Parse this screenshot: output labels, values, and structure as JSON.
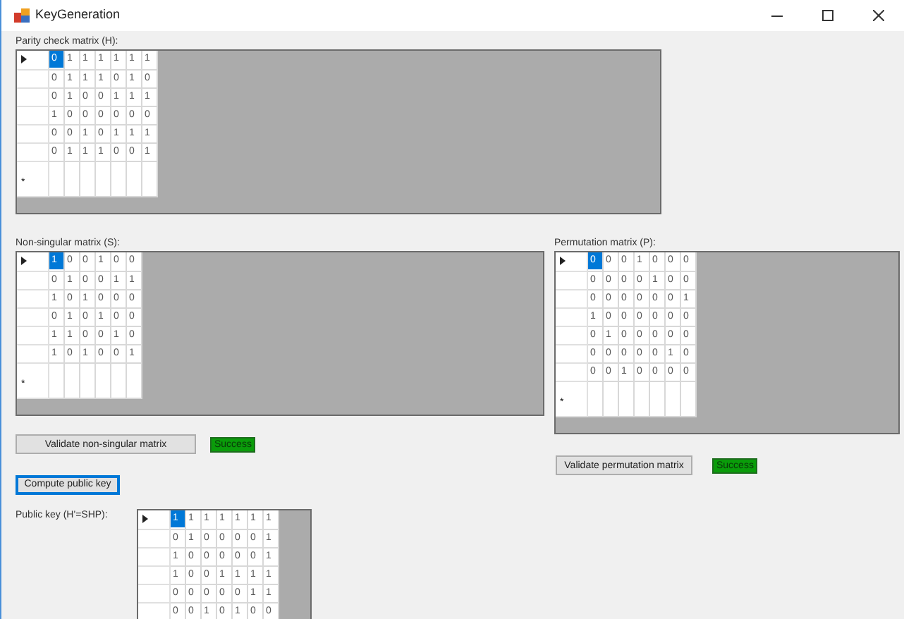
{
  "window": {
    "title": "KeyGeneration"
  },
  "parity_check": {
    "label": "Parity check matrix (H):",
    "new_row_marker": "*",
    "rows": [
      {
        "current": true,
        "cells": [
          "0",
          "1",
          "1",
          "1",
          "1",
          "1",
          "1"
        ]
      },
      {
        "current": false,
        "cells": [
          "0",
          "1",
          "1",
          "1",
          "0",
          "1",
          "0"
        ]
      },
      {
        "current": false,
        "cells": [
          "0",
          "1",
          "0",
          "0",
          "1",
          "1",
          "1"
        ]
      },
      {
        "current": false,
        "cells": [
          "1",
          "0",
          "0",
          "0",
          "0",
          "0",
          "0"
        ]
      },
      {
        "current": false,
        "cells": [
          "0",
          "0",
          "1",
          "0",
          "1",
          "1",
          "1"
        ]
      },
      {
        "current": false,
        "cells": [
          "0",
          "1",
          "1",
          "1",
          "0",
          "0",
          "1"
        ]
      }
    ]
  },
  "non_singular": {
    "label": "Non-singular matrix (S):",
    "new_row_marker": "*",
    "rows": [
      {
        "current": true,
        "cells": [
          "1",
          "0",
          "0",
          "1",
          "0",
          "0"
        ]
      },
      {
        "current": false,
        "cells": [
          "0",
          "1",
          "0",
          "0",
          "1",
          "1"
        ]
      },
      {
        "current": false,
        "cells": [
          "1",
          "0",
          "1",
          "0",
          "0",
          "0"
        ]
      },
      {
        "current": false,
        "cells": [
          "0",
          "1",
          "0",
          "1",
          "0",
          "0"
        ]
      },
      {
        "current": false,
        "cells": [
          "1",
          "1",
          "0",
          "0",
          "1",
          "0"
        ]
      },
      {
        "current": false,
        "cells": [
          "1",
          "0",
          "1",
          "0",
          "0",
          "1"
        ]
      }
    ]
  },
  "permutation": {
    "label": "Permutation matrix (P):",
    "new_row_marker": "*",
    "rows": [
      {
        "current": true,
        "cells": [
          "0",
          "0",
          "0",
          "1",
          "0",
          "0",
          "0"
        ]
      },
      {
        "current": false,
        "cells": [
          "0",
          "0",
          "0",
          "0",
          "1",
          "0",
          "0"
        ]
      },
      {
        "current": false,
        "cells": [
          "0",
          "0",
          "0",
          "0",
          "0",
          "0",
          "1"
        ]
      },
      {
        "current": false,
        "cells": [
          "1",
          "0",
          "0",
          "0",
          "0",
          "0",
          "0"
        ]
      },
      {
        "current": false,
        "cells": [
          "0",
          "1",
          "0",
          "0",
          "0",
          "0",
          "0"
        ]
      },
      {
        "current": false,
        "cells": [
          "0",
          "0",
          "0",
          "0",
          "0",
          "1",
          "0"
        ]
      },
      {
        "current": false,
        "cells": [
          "0",
          "0",
          "1",
          "0",
          "0",
          "0",
          "0"
        ]
      }
    ]
  },
  "validate_non_singular": {
    "label": "Validate non-singular matrix",
    "focused": false,
    "status": "Success"
  },
  "compute_public_key": {
    "label": "Compute public key",
    "focused": true
  },
  "validate_permutation": {
    "label": "Validate permutation matrix",
    "focused": false,
    "status": "Success"
  },
  "public_key": {
    "label": "Public key (H'=SHP):",
    "rows": [
      {
        "current": true,
        "cells": [
          "1",
          "1",
          "1",
          "1",
          "1",
          "1",
          "1"
        ]
      },
      {
        "current": false,
        "cells": [
          "0",
          "1",
          "0",
          "0",
          "0",
          "0",
          "1"
        ]
      },
      {
        "current": false,
        "cells": [
          "1",
          "0",
          "0",
          "0",
          "0",
          "0",
          "1"
        ]
      },
      {
        "current": false,
        "cells": [
          "1",
          "0",
          "0",
          "1",
          "1",
          "1",
          "1"
        ]
      },
      {
        "current": false,
        "cells": [
          "0",
          "0",
          "0",
          "0",
          "0",
          "1",
          "1"
        ]
      },
      {
        "current": false,
        "cells": [
          "0",
          "0",
          "1",
          "0",
          "1",
          "0",
          "0"
        ]
      }
    ]
  }
}
